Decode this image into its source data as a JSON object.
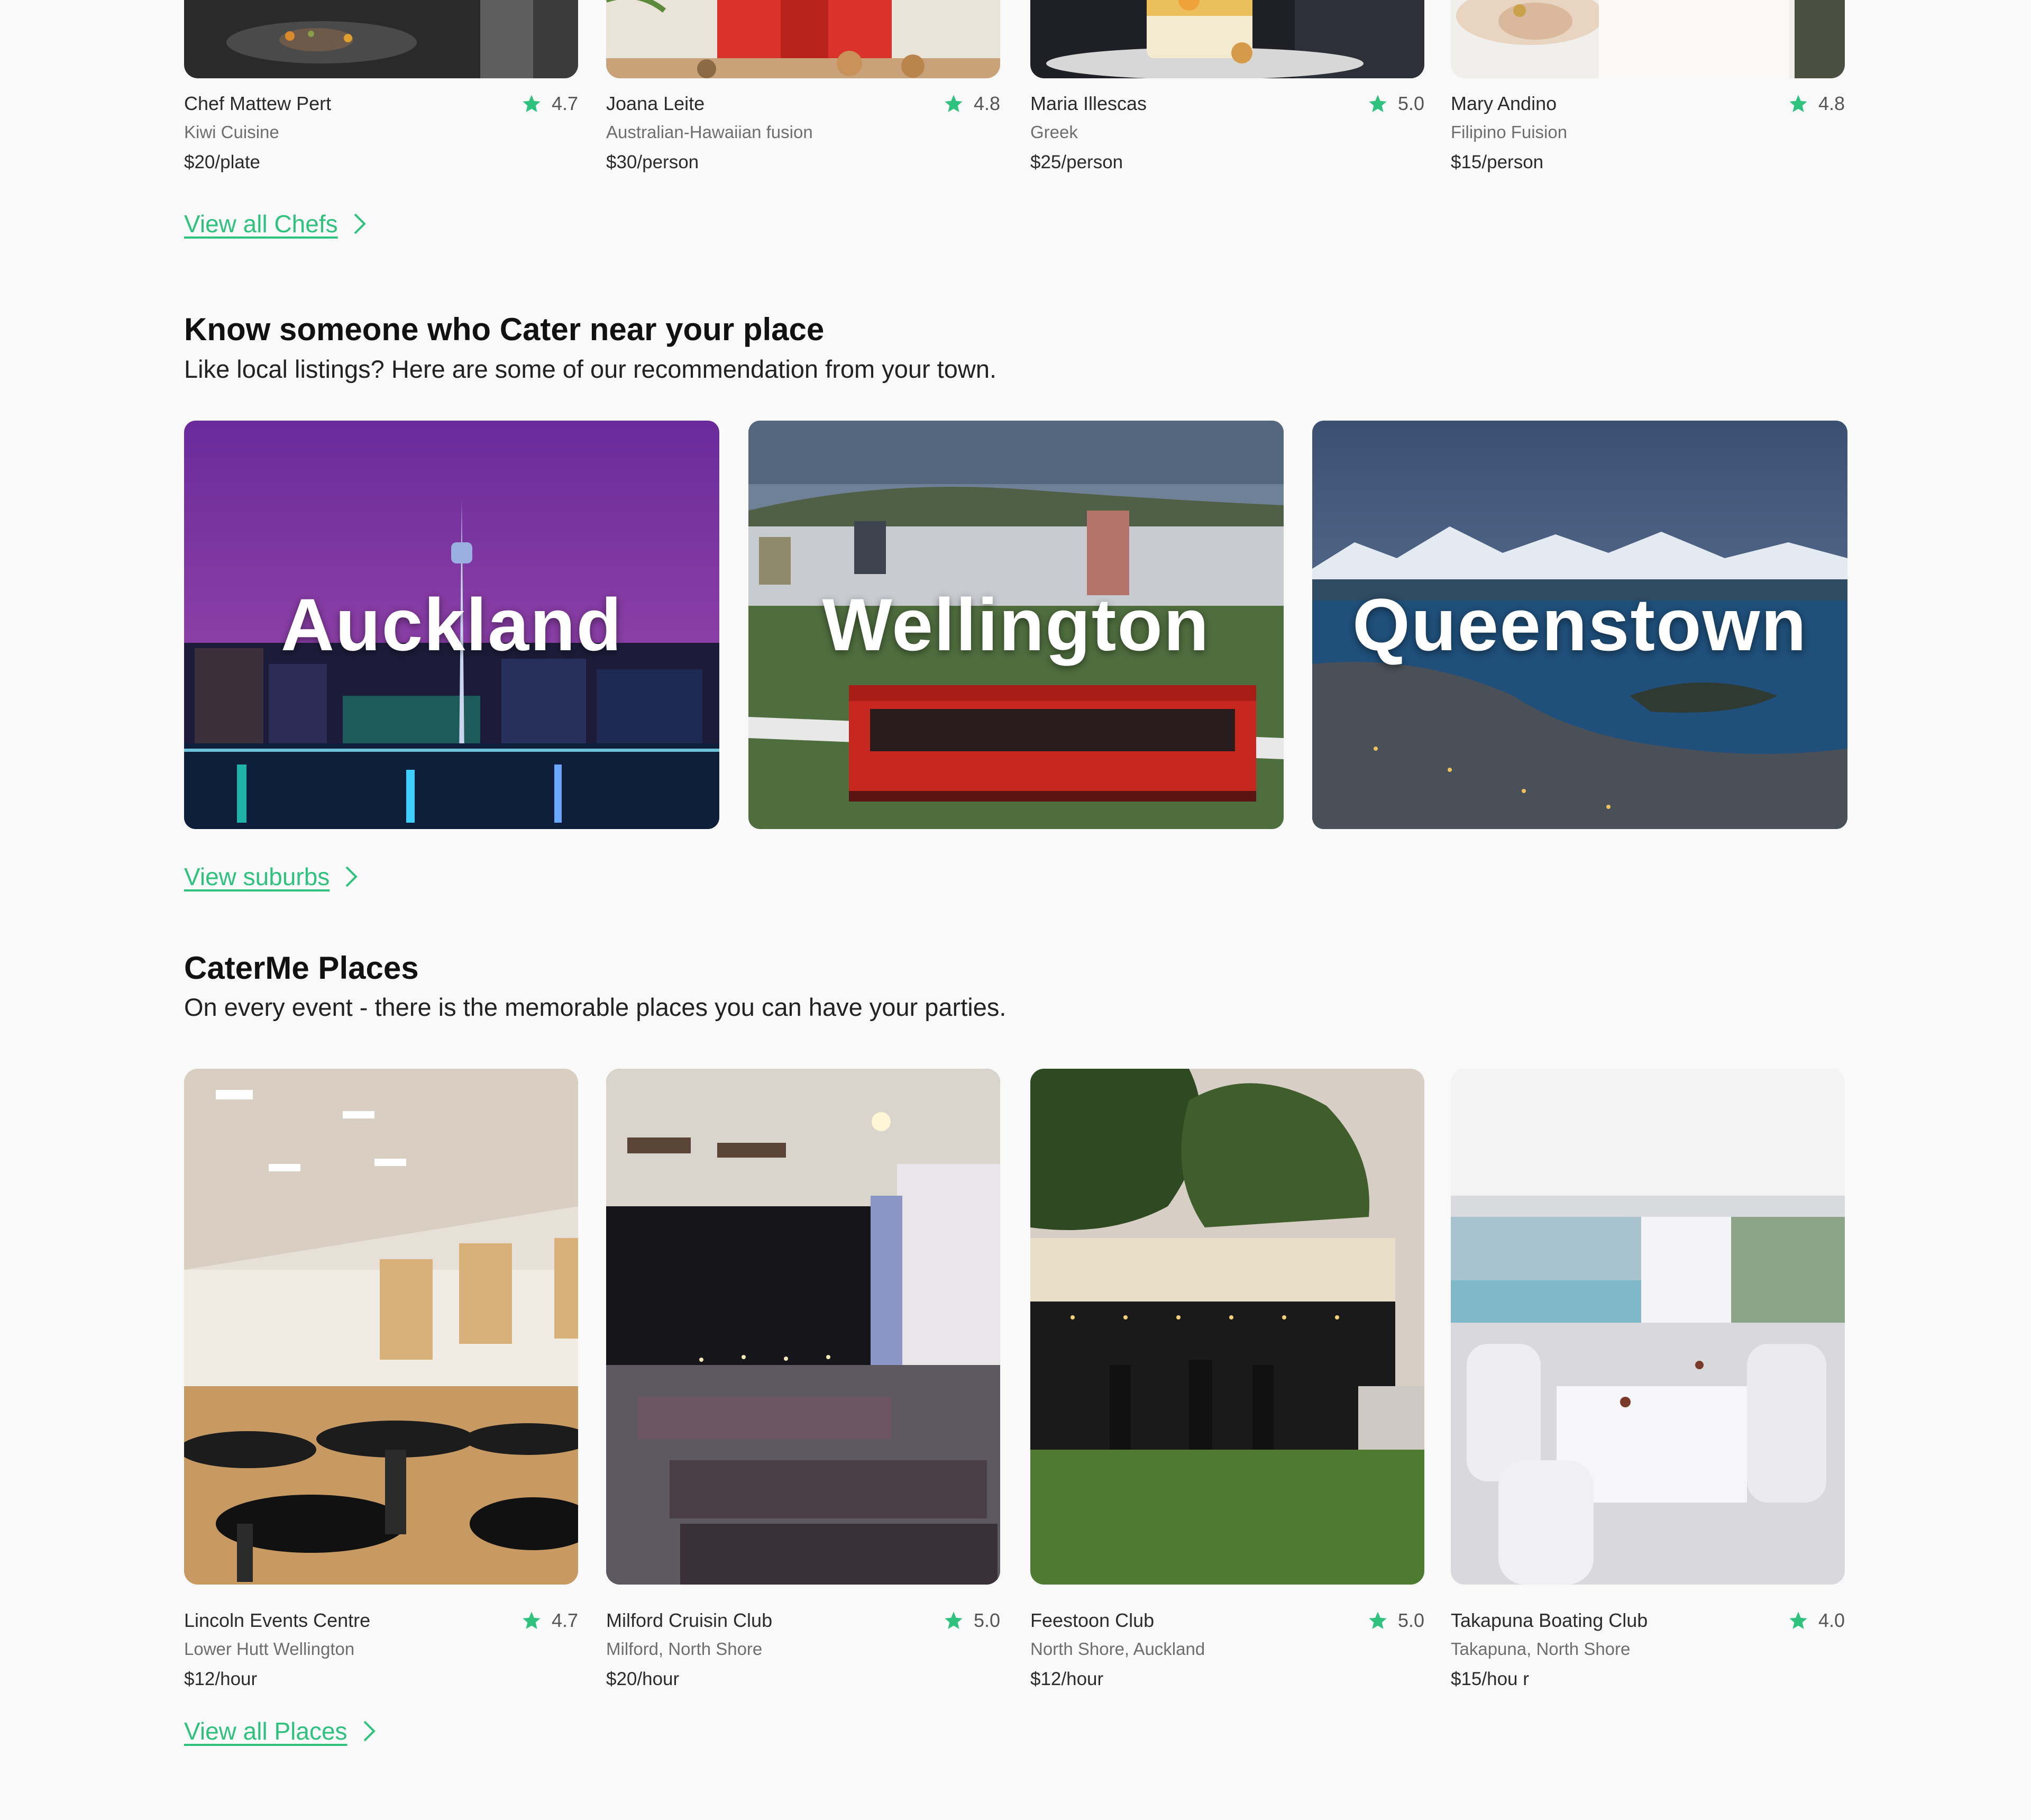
{
  "chefs": {
    "items": [
      {
        "name": "Chef Mattew Pert",
        "rating": "4.7",
        "subtitle": "Kiwi Cuisine",
        "price": "$20/plate"
      },
      {
        "name": "Joana Leite",
        "rating": "4.8",
        "subtitle": "Australian-Hawaiian fusion",
        "price": "$30/person"
      },
      {
        "name": "Maria Illescas",
        "rating": "5.0",
        "subtitle": "Greek",
        "price": "$25/person"
      },
      {
        "name": "Mary Andino",
        "rating": "4.8",
        "subtitle": "Filipino Fuision",
        "price": "$15/person"
      }
    ],
    "view_all": "View all Chefs"
  },
  "local": {
    "title": "Know someone who Cater near your place",
    "subtitle": "Like local listings? Here are some of our recommendation from your town.",
    "cities": [
      {
        "name": "Auckland"
      },
      {
        "name": "Wellington"
      },
      {
        "name": "Queenstown"
      }
    ],
    "view_all": "View suburbs"
  },
  "places": {
    "title": "CaterMe Places",
    "subtitle": "On every event - there is the memorable places you can have your parties.",
    "items": [
      {
        "name": "Lincoln Events Centre",
        "rating": "4.7",
        "subtitle": "Lower Hutt Wellington",
        "price": "$12/hour"
      },
      {
        "name": "Milford Cruisin Club",
        "rating": "5.0",
        "subtitle": "Milford, North Shore",
        "price": "$20/hour"
      },
      {
        "name": "Feestoon Club",
        "rating": "5.0",
        "subtitle": "North Shore, Auckland",
        "price": "$12/hour"
      },
      {
        "name": "Takapuna Boating Club",
        "rating": "4.0",
        "subtitle": "Takapuna, North Shore",
        "price": "$15/hou r"
      }
    ],
    "view_all": "View all Places"
  },
  "colors": {
    "accent": "#2ec27e",
    "star": "#2ec27e",
    "background": "#f9f9f9"
  }
}
